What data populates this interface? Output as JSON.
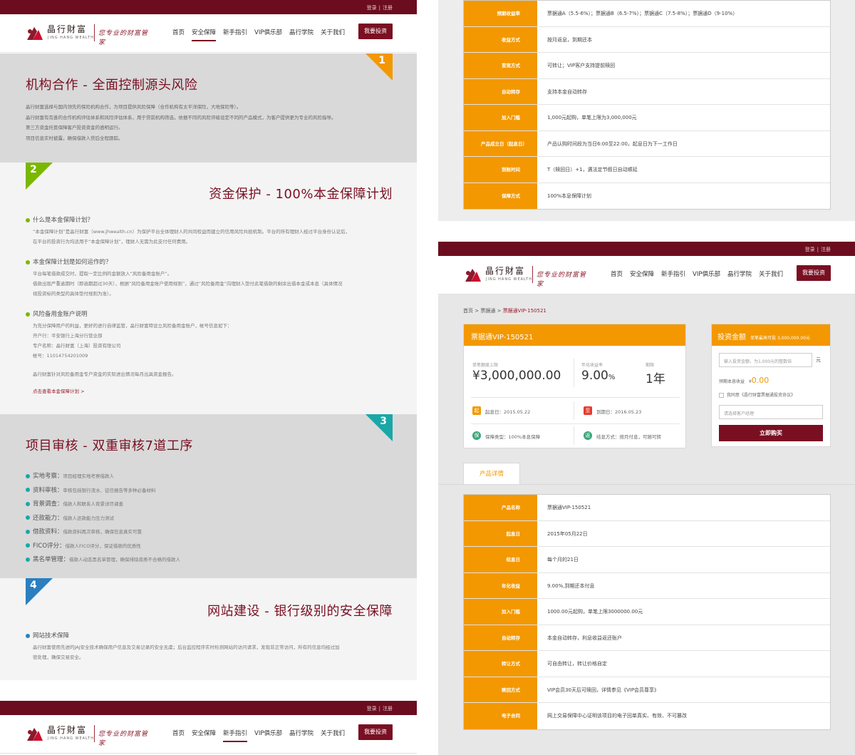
{
  "header": {
    "login": "登录",
    "sep": "|",
    "register": "注册",
    "logo_cn": "晶行財富",
    "logo_en": "JING HANG WEALTH",
    "slogan": "您专业的财富管家",
    "nav": [
      "首页",
      "安全保障",
      "新手指引",
      "VIP俱乐部",
      "晶行学院",
      "关于我们"
    ],
    "invest_button": "我要投资"
  },
  "security_page": {
    "s1": {
      "number": "1",
      "title": "机构合作 - 全面控制源头风险",
      "paragraphs": [
        "晶行财富选择与国内领先的保险机构合作，为项目提供风险保障（合作机构有太平洋保险，大地保险等）。",
        "晶行财富有完善的合作机构评估体系和风险评估体系，用于贷前机构筛选，依据不同的风险评级设定不同的产品模式，为客户提供更为专业的风险指导。",
        "第三方资金托管保障客户投资资金的透明运行。",
        "项目信息实时披露，确保借款人贷后全程跟踪。"
      ]
    },
    "s2": {
      "number": "2",
      "title": "资金保护 - 100%本金保障计划",
      "q1": "什么是本金保障计划？",
      "q1_lines": [
        "“本金保障计划”是晶行财富（www.jhwealth.cn）为保护平台全体理财人的共同权益而建立的信用风险共担机制。平台的所有理财人经过平台身份认证后，",
        "在平台的投资行为均适用于“本金保障计划”，理财人无需为此支付任何费用。"
      ],
      "q2": "本金保障计划是如何运作的？",
      "q2_lines": [
        "平台每笔借款成交时，提取一定比例的金额放入“风险备用金账户”。",
        "借款出现严重逾期时（即逾期超过30天），根据“风险备用金账户使用规则”，通过“风险备用金”向理财人垫付此笔借款的剩余出借本金或本息（具体情况",
        "视投资标的类型的具体垫付规则为准）。"
      ],
      "q3": "风险备用金账户说明",
      "q3_lines": [
        "为充分保障用户的利益，更好的进行自律监管，晶行财富特设立风险备用金账户，帐号信息如下：",
        "开户行：平安银行上海分行营业部",
        "专户名称：晶行财富（上海）投资有限公司",
        "帐号：11014754201009"
      ],
      "report": "晶行财富针对风险备用金专户资金的实际进出情况每月出具资金报告。",
      "link": "点击查看本金保障计划 >"
    },
    "s3": {
      "number": "3",
      "title": "项目审核 - 双重审核7道工序",
      "items": [
        {
          "name": "实地考察：",
          "desc": "项目经理实地考察借款人"
        },
        {
          "name": "资料审核：",
          "desc": "审核包括银行流水、征信报告等多种必备材料"
        },
        {
          "name": "背景调查：",
          "desc": "借款人和联系人背景详尽调查"
        },
        {
          "name": "还款能力：",
          "desc": "借款人还款能力压力测试"
        },
        {
          "name": "借款资料：",
          "desc": "借款资料再次审核，确保信息真实可靠"
        },
        {
          "name": "FICO评分：",
          "desc": "借款人FICO评分，保证借款的优质性"
        },
        {
          "name": "黑名单管理：",
          "desc": "借款人动态黑名单管理，确保排除资质不合格的借款人"
        }
      ]
    },
    "s4": {
      "number": "4",
      "title": "网站建设 - 银行级别的安全保障",
      "q": "网站技术保障",
      "lines": [
        "晶行财富使用先进的JAJ安全技术确保用户信息及交易记录的安全无虞；后台监控程序实时检测网站的访问请求，发现非正常访问，所有的信息均经过加",
        "密处理，确保交易安全。"
      ]
    }
  },
  "top_table": [
    {
      "k": "预期收益率",
      "v": "票据通A（5.5-6%）；票据通B（6.5-7%）；票据通C（7.5-8%）；票据通D（9-10%）"
    },
    {
      "k": "收益方式",
      "v": "按月返息，到期还本"
    },
    {
      "k": "变现方式",
      "v": "可转让；VIP客户支持提前赎回"
    },
    {
      "k": "自动转存",
      "v": "支持本金自动转存"
    },
    {
      "k": "加入门槛",
      "v": "1,000元起购，单笔上限为3,000,000元"
    },
    {
      "k": "产品成立日（起息日）",
      "v": "产品认购时间段为当日6:00至22:00，起息日为下一工作日"
    },
    {
      "k": "到账时间",
      "v": "T（赎回日）+1，遇法定节假日自动顺延"
    },
    {
      "k": "保障方式",
      "v": "100%本息保障计划"
    }
  ],
  "product": {
    "breadcrumb": [
      "首页",
      "票据通",
      "票据通VIP-150521"
    ],
    "breadcrumb_sep": ">",
    "title": "票据通VIP-150521",
    "limit_label": "单笔额度上限",
    "limit_value": "¥3,000,000.00",
    "rate_label": "年化收益率",
    "rate_value": "9.00",
    "rate_unit": "%",
    "term_label": "期限",
    "term_value": "1年",
    "start": "起息日：2015.05.22",
    "end": "到期日：2016.05.23",
    "guarantee": "保障类型：100%本息保障",
    "redeem": "结息方式：按月付息，可随可转",
    "ic_start": "起",
    "ic_end": "至",
    "ic_bao": "保",
    "ic_jie": "返"
  },
  "invest_box": {
    "title": "投资金额",
    "remaining": "单笔最高可投 3,000,000.00元",
    "input_placeholder": "输入投资金额，为1,000元的整数倍",
    "unit": "元",
    "expected_label": "预期本息收益",
    "expected_currency": "¥",
    "expected_value": "0.00",
    "agree": "我同意《晶行财富票据通投资协议》",
    "manager_placeholder": "请选择客户经理",
    "buy_button": "立即购买"
  },
  "details_tab": "产品详情",
  "detail_table": [
    {
      "k": "产品名称",
      "v": "票据通VIP-150521"
    },
    {
      "k": "起息日",
      "v": "2015年05月22日"
    },
    {
      "k": "结息日",
      "v": "每个月的21日"
    },
    {
      "k": "年化收益",
      "v": "9.00%,到期还本付息"
    },
    {
      "k": "加入门槛",
      "v": "1000.00元起购，单笔上限3000000.00元"
    },
    {
      "k": "自动转存",
      "v": "本金自动转存，利息收益返还账户"
    },
    {
      "k": "转让方式",
      "v": "可自由转让，转让价格自定"
    },
    {
      "k": "赎回方式",
      "v": "VIP会员30天后可赎回，详情参见《VIP会员尊享》"
    },
    {
      "k": "电子合同",
      "v": "网上交易保障中心证明该项目的电子回单真实、有效、不可篡改"
    }
  ],
  "colors": {
    "brand": "#7a0f22",
    "orange": "#f39800",
    "green": "#7ab800",
    "teal": "#1aa7a7",
    "blue": "#2a7fc0"
  }
}
